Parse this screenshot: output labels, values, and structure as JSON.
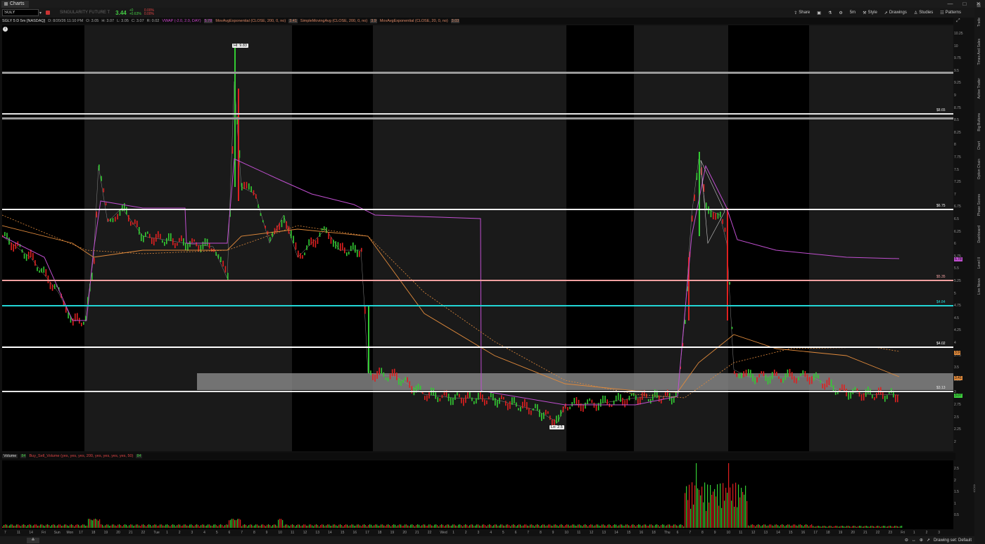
{
  "window": {
    "tab_label": "Charts",
    "controls": [
      "—",
      "□",
      "✕"
    ]
  },
  "toolbar": {
    "symbol": "SGLY",
    "symbol_name": "SINGULARITY FUTURE T",
    "last": "3.44",
    "change": "+0",
    "change2": "+0.63%",
    "pct": "0.00%",
    "pct2": "0.00%",
    "share_label": "Share",
    "style_label": "Style",
    "drawings_label": "Drawings",
    "studies_label": "Studies",
    "patterns_label": "Patterns",
    "timeframe_label": "5m"
  },
  "studybar": {
    "symbol_desc": "SGLY 5 D 5m [NASDAQ]",
    "date": "D: 8/20/26 11:10 PM",
    "open": "O: 3.05",
    "high": "H: 3.07",
    "low": "L: 3.05",
    "close": "C: 3.07",
    "range": "R: 0.02",
    "vwap": "VWAP (-2.0, 2.0, DAY)",
    "vwap_val": "5.78",
    "ema200": "MovAvgExponential (CLOSE, 200, 0, no)",
    "ema200_val": "3.41",
    "sma200": "SimpleMovingAvg (CLOSE, 200, 0, no)",
    "sma200_val": "3.9",
    "ema20": "MovAvgExponential (CLOSE, 20, 0, no)",
    "ema20_val": "3.03"
  },
  "price_axis": [
    "10.25",
    "10",
    "9.75",
    "9.5",
    "9.25",
    "9",
    "8.75",
    "8.5",
    "8.25",
    "8",
    "7.75",
    "7.5",
    "7.25",
    "7",
    "6.75",
    "6.5",
    "6.25",
    "6",
    "5.75",
    "5.5",
    "5.25",
    "5",
    "4.75",
    "4.5",
    "4.25",
    "4",
    "3.75",
    "3.5",
    "3.25",
    "3",
    "2.75",
    "2.5",
    "2.25",
    "2"
  ],
  "levels": [
    {
      "label": "",
      "color": "#9a9a9a"
    },
    {
      "label": "$8.65",
      "color": "#e6e6e6"
    },
    {
      "label": "",
      "color": "#9a9a9a"
    },
    {
      "label": "$6.75",
      "color": "#f2f2f2"
    },
    {
      "label": "$5.35",
      "color": "#f0a0a0"
    },
    {
      "label": "$4.84",
      "color": "#22d6d6"
    },
    {
      "label": "$4.02",
      "color": "#ffffff"
    },
    {
      "label": "$3.13",
      "color": "#e6e6e6"
    }
  ],
  "price_tags": [
    {
      "text": "5.78",
      "color": "#c04fd0"
    },
    {
      "text": "3.9",
      "color": "#e08a3c"
    },
    {
      "text": "3.41",
      "color": "#e08a3c"
    },
    {
      "text": "3.07",
      "color": "#3ed13e"
    }
  ],
  "callouts": {
    "hi": "Hi: 9.83",
    "lo": "Lo: 2.5"
  },
  "volume": {
    "label": "Volume",
    "value": "84",
    "study": "Buy_Sell_Volume (yes, yes, yes, 200, yes, yes, yes, yes, 50)",
    "study_val": "84",
    "axis": [
      "2.5",
      "2",
      "1.5",
      "1",
      "0.5"
    ]
  },
  "time_axis": [
    "7",
    "11",
    "14",
    "Fri",
    "Sun",
    "Mon",
    "17",
    "18",
    "19",
    "20",
    "21",
    "22",
    "Tue",
    "1",
    "2",
    "3",
    "4",
    "5",
    "6",
    "7",
    "8",
    "9",
    "10",
    "11",
    "12",
    "13",
    "14",
    "15",
    "16",
    "17",
    "18",
    "19",
    "20",
    "21",
    "22",
    "Wed",
    "1",
    "2",
    "3",
    "4",
    "5",
    "6",
    "7",
    "8",
    "9",
    "10",
    "11",
    "12",
    "13",
    "14",
    "15",
    "16",
    "18",
    "Thu",
    "6",
    "7",
    "8",
    "9",
    "10",
    "11",
    "12",
    "13",
    "14",
    "15",
    "16",
    "17",
    "18",
    "19",
    "20",
    "21",
    "22",
    "23",
    "Fri",
    "1",
    "2",
    "3"
  ],
  "side_tabs": [
    "Trade",
    "Times And Sales",
    "Active Trader",
    "Big Buttons",
    "Chart",
    "Option Chain",
    "Phase Scores",
    "Dashboard",
    "Level II",
    "Live News"
  ],
  "bottom": {
    "drawing_set": "Drawing set: Default"
  },
  "colors": {
    "up": "#33cc33",
    "down": "#e02020",
    "vwap": "#c04fd0",
    "ema": "#e08a3c"
  }
}
